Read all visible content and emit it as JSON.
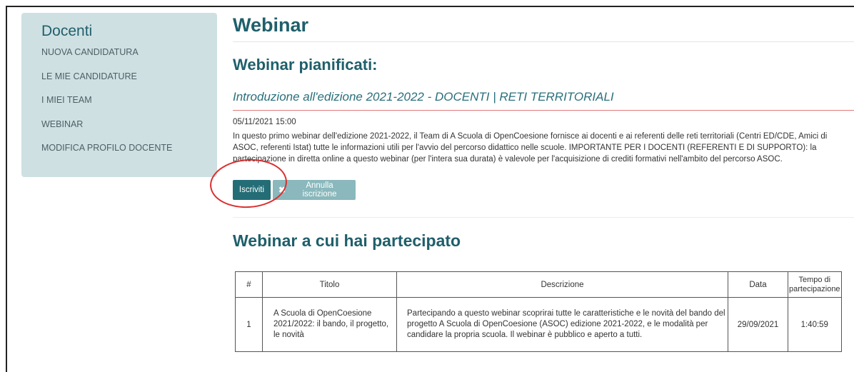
{
  "sidebar": {
    "title": "Docenti",
    "items": [
      {
        "label": "NUOVA CANDIDATURA"
      },
      {
        "label": "LE MIE CANDIDATURE"
      },
      {
        "label": "I MIEI TEAM"
      },
      {
        "label": "WEBINAR"
      },
      {
        "label": "MODIFICA PROFILO DOCENTE"
      }
    ]
  },
  "main": {
    "page_title": "Webinar",
    "planned_title": "Webinar pianificati:",
    "webinar": {
      "title": "Introduzione all'edizione 2021-2022 - DOCENTI | RETI TERRITORIALI",
      "date": "05/11/2021 15:00",
      "description": "In questo primo webinar dell'edizione 2021-2022, il Team di A Scuola di OpenCoesione fornisce ai docenti e ai referenti delle reti territoriali (Centri ED/CDE, Amici di ASOC, referenti Istat) tutte le informazioni utili per l'avvio del percorso didattico nelle scuole. IMPORTANTE PER I DOCENTI (REFERENTI E DI SUPPORTO): la partecipazione in diretta online a questo webinar (per l'intera sua durata) è valevole per l'acquisizione di crediti formativi nell'ambito del percorso ASOC.",
      "subscribe_label": "Iscriviti",
      "unsubscribe_label": "Annulla iscrizione"
    },
    "attended_title": "Webinar a cui hai partecipato",
    "table": {
      "headers": [
        "#",
        "Titolo",
        "Descrizione",
        "Data",
        "Tempo di partecipazione"
      ],
      "rows": [
        {
          "num": "1",
          "titolo": "A Scuola di OpenCoesione 2021/2022: il bando, il progetto, le novità",
          "descrizione": "Partecipando a questo webinar scoprirai tutte le caratteristiche e le novità del bando del progetto A Scuola di OpenCoesione (ASOC) edizione 2021-2022, e le modalità per candidare la propria scuola. Il webinar è pubblico e aperto a tutti.",
          "data": "29/09/2021",
          "tempo": "1:40:59"
        }
      ]
    }
  },
  "colors": {
    "sidebar_bg": "#cfe0e3",
    "heading": "#1f5f6b",
    "primary_button": "#246d76",
    "secondary_button": "#8ab8bc",
    "annotation_circle": "#d9302f"
  }
}
